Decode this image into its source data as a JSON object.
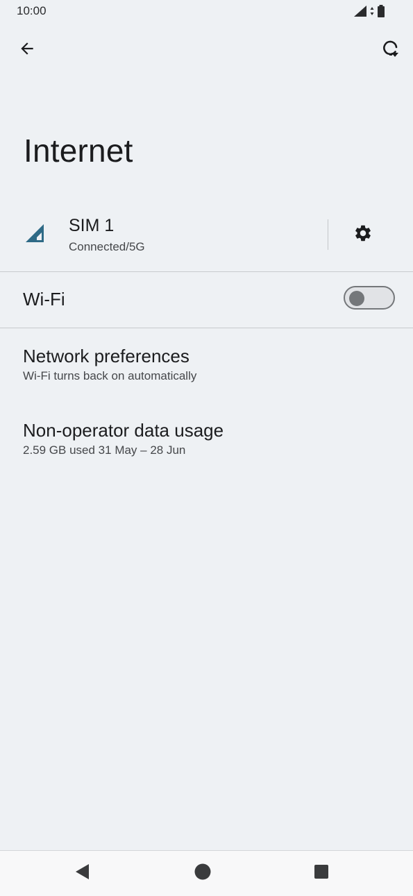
{
  "status_bar": {
    "time": "10:00",
    "icons": [
      "signal-icon",
      "data-arrows-icon",
      "battery-icon"
    ]
  },
  "top_bar": {
    "back_icon": "back-arrow-icon",
    "help_icon": "help-refresh-icon"
  },
  "page": {
    "title": "Internet"
  },
  "sim": {
    "title": "SIM 1",
    "subtitle": "Connected/5G",
    "settings_icon": "gear-icon",
    "accent_color": "#2e6a86"
  },
  "wifi": {
    "label": "Wi-Fi",
    "enabled": false
  },
  "preferences": [
    {
      "title": "Network preferences",
      "subtitle": "Wi-Fi turns back on automatically"
    },
    {
      "title": "Non-operator data usage",
      "subtitle": "2.59 GB used 31 May – 28 Jun"
    }
  ],
  "nav_bar": {
    "back": "nav-back-icon",
    "home": "nav-home-icon",
    "recents": "nav-recents-icon"
  }
}
